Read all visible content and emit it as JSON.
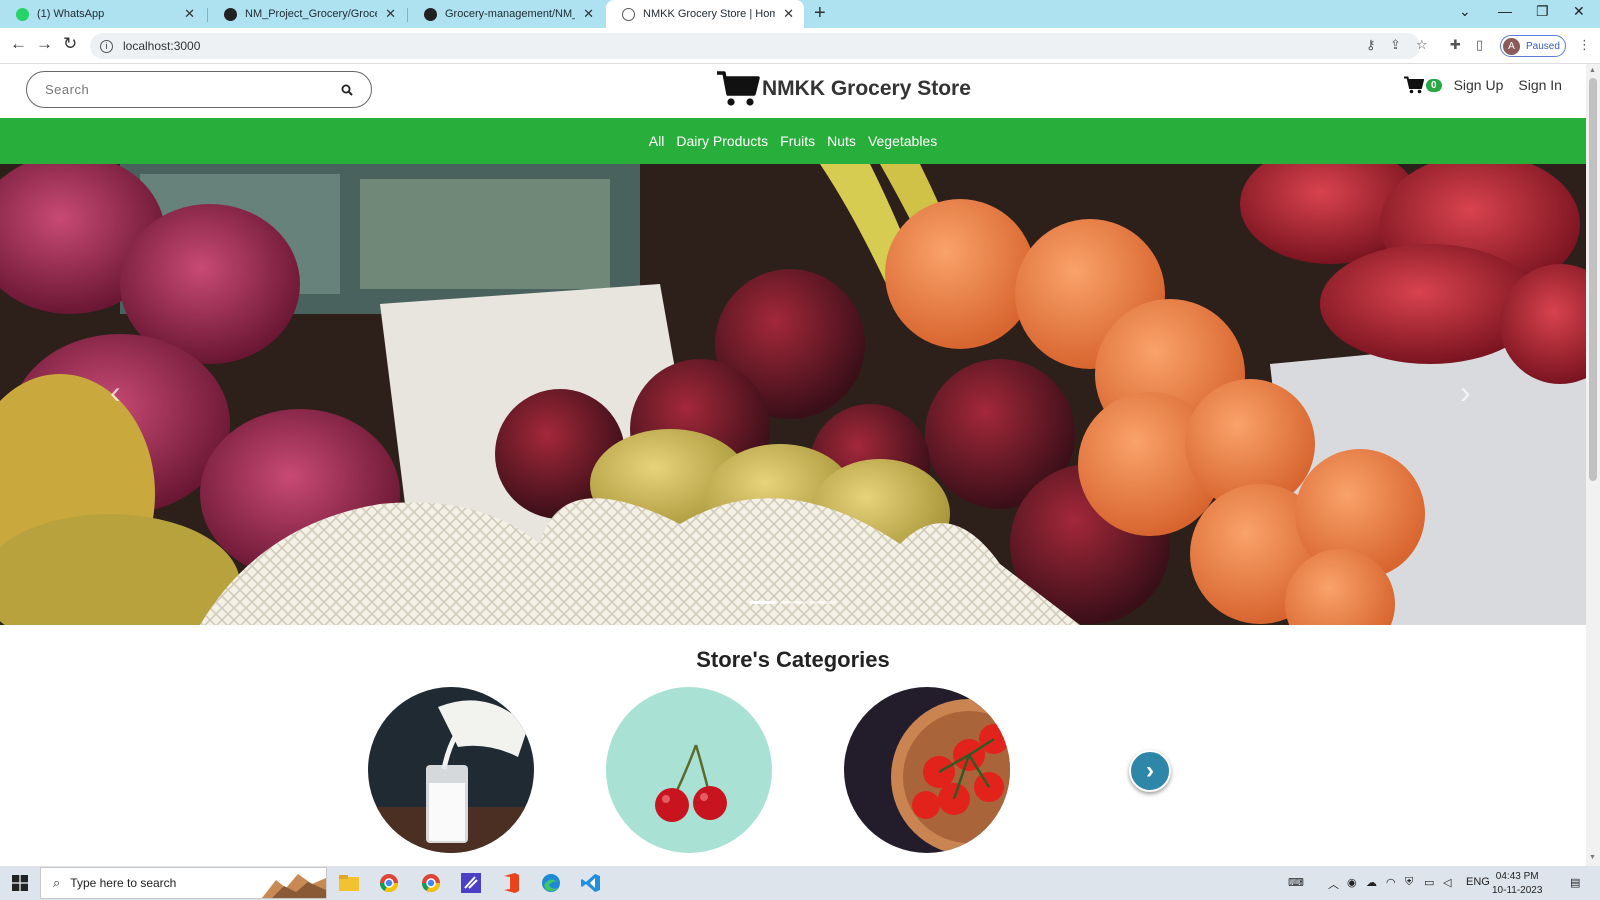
{
  "browser": {
    "tabs": [
      {
        "title": "(1) WhatsApp",
        "icon": "whatsapp-icon",
        "active": false
      },
      {
        "title": "NM_Project_Grocery/Grocery at",
        "icon": "github-icon",
        "active": false
      },
      {
        "title": "Grocery-management/NM_Proje",
        "icon": "github-icon",
        "active": false
      },
      {
        "title": "NMKK Grocery Store | Home",
        "icon": "globe-icon",
        "active": true
      }
    ],
    "url": "localhost:3000",
    "profile_initial": "A",
    "profile_status": "Paused"
  },
  "header": {
    "search_placeholder": "Search",
    "brand_title": "NMKK Grocery Store",
    "cart_count": "0",
    "sign_up": "Sign Up",
    "sign_in": "Sign In"
  },
  "nav": {
    "items": [
      "All",
      "Dairy Products",
      "Fruits",
      "Nuts",
      "Vegetables"
    ]
  },
  "carousel": {
    "slide_count": 3,
    "active_slide": 1
  },
  "categories": {
    "title": "Store's Categories",
    "items": [
      {
        "icon": "milk-image"
      },
      {
        "icon": "cherries-image"
      },
      {
        "icon": "tomatoes-image"
      }
    ]
  },
  "taskbar": {
    "search_placeholder": "Type here to search",
    "lang": "ENG",
    "time": "04:43 PM",
    "date": "10-11-2023"
  },
  "colors": {
    "nav_green": "#28ae3a",
    "tabstrip": "#aee2f1",
    "badge_green": "#28a745",
    "next_button": "#2e86a8"
  }
}
